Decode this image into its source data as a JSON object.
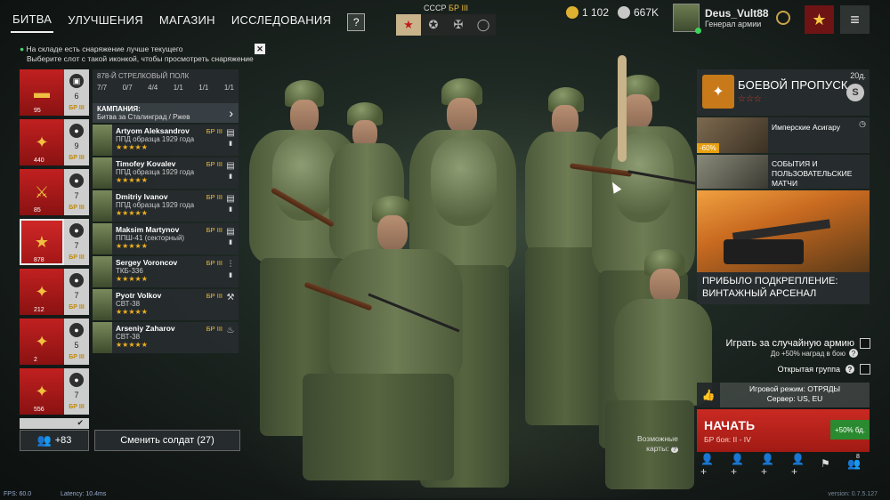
{
  "nav": {
    "items": [
      "БИТВА",
      "УЛУЧШЕНИЯ",
      "МАГАЗИН",
      "ИССЛЕДОВАНИЯ"
    ],
    "help": "?"
  },
  "nation": {
    "label": "СССР",
    "br": "БР III",
    "tabs": [
      "★",
      "✪",
      "✠",
      "◯"
    ]
  },
  "currency": {
    "gold": "1 102",
    "silver": "667K",
    "gold_color": "#e0b030",
    "silver_color": "#c8c8c8"
  },
  "profile": {
    "name": "Deus_Vult88",
    "rank": "Генерал армии"
  },
  "notice": {
    "line1": "На складе есть снаряжение лучше текущего",
    "line2": "Выберите слот с такой иконкой, чтобы просмотреть снаряжение",
    "close": "✕"
  },
  "squads": [
    {
      "icon": "tank-icon",
      "count": "6",
      "br": "БР III",
      "num": "95"
    },
    {
      "icon": "soldier-icon",
      "count": "9",
      "br": "БР III",
      "num": "440"
    },
    {
      "icon": "soldier-icon",
      "count": "7",
      "br": "БР III",
      "num": "85"
    },
    {
      "icon": "soldier-icon",
      "count": "7",
      "br": "БР III",
      "num": "878"
    },
    {
      "icon": "soldier-icon",
      "count": "7",
      "br": "БР III",
      "num": "212"
    },
    {
      "icon": "soldier-icon",
      "count": "5",
      "br": "БР III",
      "num": "2"
    },
    {
      "icon": "soldier-icon",
      "count": "7",
      "br": "БР III",
      "num": "556"
    }
  ],
  "squad_panel": {
    "title": "878-Й СТРЕЛКОВЫЙ ПОЛК",
    "stats": [
      "7/7",
      "0/7",
      "4/4",
      "1/1",
      "1/1",
      "1/1"
    ],
    "campaign_title": "КАМПАНИЯ:",
    "campaign_sub": "Битва за Сталинград / Ржев"
  },
  "soldiers": [
    {
      "name": "Artyom Aleksandrov",
      "weapon": "ППД образца 1929 года",
      "br": "БР III",
      "stars": "★★★★★"
    },
    {
      "name": "Timofey Kovalev",
      "weapon": "ППД образца 1929 года",
      "br": "БР III",
      "stars": "★★★★★"
    },
    {
      "name": "Dmitriy Ivanov",
      "weapon": "ППД образца 1929 года",
      "br": "БР III",
      "stars": "★★★★★"
    },
    {
      "name": "Maksim Martynov",
      "weapon": "ППШ-41 (секторный)",
      "br": "БР III",
      "stars": "★★★★★"
    },
    {
      "name": "Sergey Voroncov",
      "weapon": "ТКБ-336",
      "br": "БР III",
      "stars": "★★★★★"
    },
    {
      "name": "Pyotr Volkov",
      "weapon": "СВТ-38",
      "br": "БР III",
      "stars": "★★★★★"
    },
    {
      "name": "Arseniy Zaharov",
      "weapon": "СВТ-38",
      "br": "БР III",
      "stars": "★★★★★"
    }
  ],
  "bottom_left": {
    "friends_count": "+83",
    "change_soldier": "Сменить солдат (27)"
  },
  "battlepass": {
    "title": "БОЕВОЙ ПРОПУСК",
    "stars": "☆☆☆",
    "days": "20д.",
    "badge": "S"
  },
  "promo_a": {
    "text": "Имперские Асигару",
    "sale": "-60%"
  },
  "promo_b": {
    "text": "СОБЫТИЯ И ПОЛЬЗОВАТЕЛЬСКИЕ МАТЧИ"
  },
  "promo_c": {
    "text": "ПРИБЫЛО ПОДКРЕПЛЕНИЕ: ВИНТАЖНЫЙ АРСЕНАЛ"
  },
  "random_army": {
    "label": "Играть за случайную армию",
    "sub": "До +50% наград в бою"
  },
  "open_group": {
    "label": "Открытая группа"
  },
  "gamemode": {
    "line1": "Игровой режим: ОТРЯДЫ",
    "line2": "Сервер: US, EU"
  },
  "start": {
    "title": "НАЧАТЬ",
    "sub": "БР боя: II - IV",
    "bonus": "+50% бд."
  },
  "maps": {
    "line1": "Возможные",
    "line2": "карты:"
  },
  "people_count": "8",
  "debug": {
    "fps": "FPS: 60.0",
    "latency": "Latency: 10.4ms",
    "version": "version: 0.7.5.127"
  }
}
